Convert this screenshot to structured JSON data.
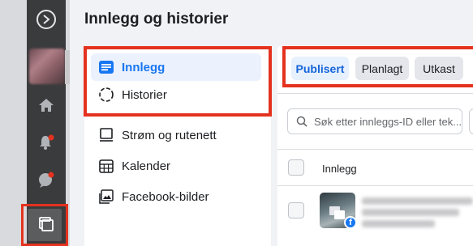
{
  "header": {
    "title": "Innlegg og historier"
  },
  "sidebar": {
    "items": [
      {
        "label": "Innlegg",
        "icon": "posts-list-icon",
        "active": true
      },
      {
        "label": "Historier",
        "icon": "stories-ring-icon",
        "active": false
      },
      {
        "label": "Strøm og rutenett",
        "icon": "feed-grid-icon",
        "active": false
      },
      {
        "label": "Kalender",
        "icon": "calendar-icon",
        "active": false
      },
      {
        "label": "Facebook-bilder",
        "icon": "photos-icon",
        "active": false
      }
    ]
  },
  "tabs": [
    {
      "label": "Publisert",
      "active": true
    },
    {
      "label": "Planlagt",
      "active": false
    },
    {
      "label": "Utkast",
      "active": false
    }
  ],
  "search": {
    "placeholder": "Søk etter innleggs-ID eller tek..."
  },
  "table": {
    "column_header": "Innlegg"
  },
  "rail": {
    "icons": [
      "meta-logo-icon",
      "home-icon",
      "notifications-icon",
      "messages-icon",
      "content-library-icon"
    ]
  },
  "colors": {
    "accent": "#1877f2",
    "highlight_border": "#e4321f",
    "rail_bg": "#3a3b3c"
  }
}
